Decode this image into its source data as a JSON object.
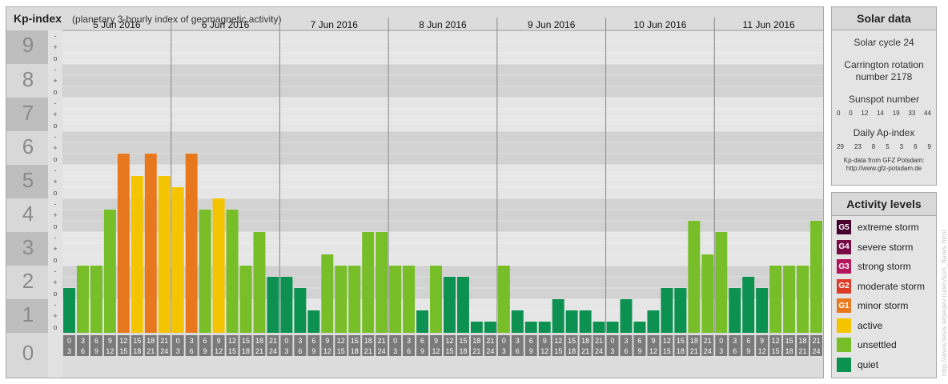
{
  "header": {
    "title": "Kp-index",
    "subtitle": "(planetary 3-hourly index of geomagnetic activity)"
  },
  "chart_data": {
    "type": "bar",
    "ylim": [
      0,
      9
    ],
    "y_ticks": [
      "0",
      "1",
      "2",
      "3",
      "4",
      "5",
      "6",
      "7",
      "8",
      "9"
    ],
    "minor_tick_labels": [
      "o",
      "+",
      "-"
    ],
    "days": [
      "5 Jun 2016",
      "6 Jun 2016",
      "7 Jun 2016",
      "8 Jun 2016",
      "9 Jun 2016",
      "10 Jun 2016",
      "11 Jun 2016"
    ],
    "interval_labels": [
      [
        "0",
        "3"
      ],
      [
        "3",
        "6"
      ],
      [
        "6",
        "9"
      ],
      [
        "9",
        "12"
      ],
      [
        "12",
        "15"
      ],
      [
        "15",
        "18"
      ],
      [
        "18",
        "21"
      ],
      [
        "21",
        "24"
      ]
    ],
    "values": [
      1.333,
      2,
      2,
      3.667,
      5.333,
      4.667,
      5.333,
      4.667,
      4.333,
      5.333,
      3.667,
      4,
      3.667,
      2,
      3,
      1.667,
      1.667,
      1.333,
      0.667,
      2.333,
      2,
      2,
      3,
      3,
      2,
      2,
      0.667,
      2,
      1.667,
      1.667,
      0.333,
      0.333,
      2,
      0.667,
      0.333,
      0.333,
      1,
      0.667,
      0.667,
      0.333,
      0.333,
      1,
      0.333,
      0.667,
      1.333,
      1.333,
      3.333,
      2.333,
      3,
      1.333,
      1.667,
      1.333,
      2,
      2,
      2,
      3.333
    ],
    "colors": {
      "quiet": "#0c9150",
      "unsettled": "#78be28",
      "active": "#f5c400",
      "g1": "#e8781e",
      "g2": "#dc3c28",
      "g3": "#b4145a",
      "g4": "#780a46",
      "g5": "#46002d"
    }
  },
  "solar_data": {
    "title": "Solar data",
    "solar_cycle": "Solar cycle 24",
    "carrington": "Carrington rotation number 2178",
    "sunspot_title": "Sunspot number",
    "sunspot_values": [
      "0",
      "0",
      "12",
      "14",
      "19",
      "33",
      "44"
    ],
    "ap_title": "Daily Ap-index",
    "ap_values": [
      "29",
      "23",
      "8",
      "5",
      "3",
      "6",
      "9"
    ],
    "source_line1": "Kp-data from GFZ Potsdam:",
    "source_line2": "http://www.gfz-potsdam.de"
  },
  "activity_levels": {
    "title": "Activity levels",
    "items": [
      {
        "code": "G5",
        "label": "extreme storm",
        "color": "#46002d"
      },
      {
        "code": "G4",
        "label": "severe storm",
        "color": "#780a46"
      },
      {
        "code": "G3",
        "label": "strong storm",
        "color": "#b4145a"
      },
      {
        "code": "G2",
        "label": "moderate storm",
        "color": "#dc3c28"
      },
      {
        "code": "G1",
        "label": "minor storm",
        "color": "#e8781e"
      },
      {
        "code": "",
        "label": "active",
        "color": "#f5c400"
      },
      {
        "code": "",
        "label": "unsettled",
        "color": "#78be28"
      },
      {
        "code": "",
        "label": "quiet",
        "color": "#0c9150"
      }
    ]
  },
  "credit": "http://www.tesis.lebedev.ru/en/sun_flares.html"
}
